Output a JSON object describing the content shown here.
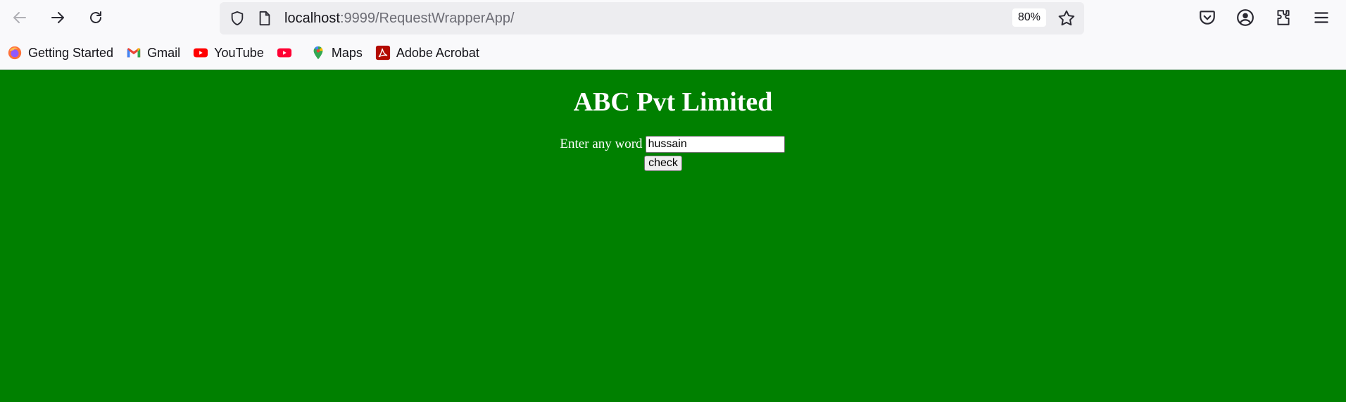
{
  "browser": {
    "url_host": "localhost",
    "url_path": ":9999/RequestWrapperApp/",
    "zoom": "80%",
    "icons": {
      "back": "back-arrow-icon",
      "forward": "forward-arrow-icon",
      "reload": "reload-icon",
      "shield": "tracking-protection-shield-icon",
      "page": "page-info-icon",
      "bookmark_star": "bookmark-star-icon",
      "pocket": "pocket-icon",
      "account": "account-icon",
      "extensions": "extensions-icon",
      "menu": "hamburger-menu-icon"
    }
  },
  "bookmarks": [
    {
      "label": "Getting Started",
      "icon": "firefox-icon"
    },
    {
      "label": "Gmail",
      "icon": "gmail-icon"
    },
    {
      "label": "YouTube",
      "icon": "youtube-icon"
    },
    {
      "label": "",
      "icon": "youtube-icon"
    },
    {
      "label": "Maps",
      "icon": "maps-pin-icon"
    },
    {
      "label": "Adobe Acrobat",
      "icon": "adobe-acrobat-icon"
    }
  ],
  "page": {
    "title": "ABC Pvt Limited",
    "label": "Enter any word",
    "input_value": "hussain",
    "button_label": "check",
    "background_color": "#008000"
  }
}
